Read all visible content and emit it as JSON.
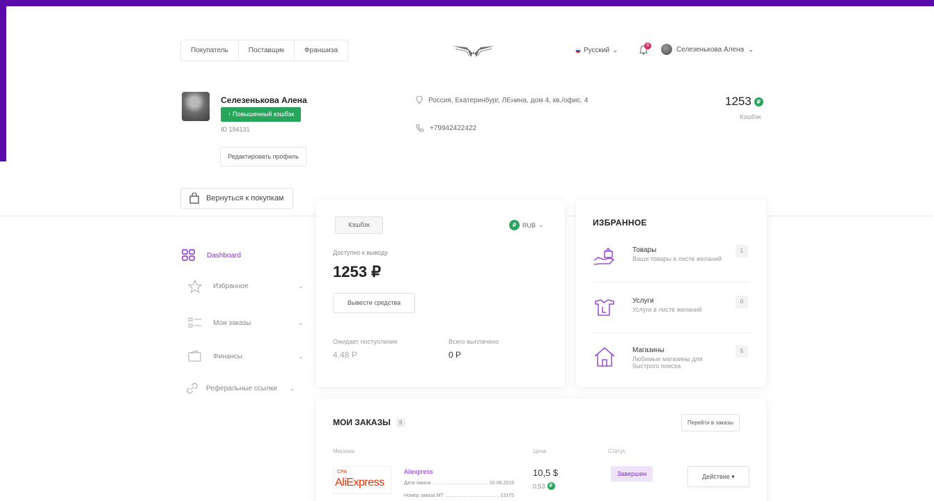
{
  "header": {
    "role_tabs": [
      "Покупатель",
      "Поставщик",
      "Франшиза"
    ],
    "language": "Русский",
    "notifications_count": "8",
    "user_name": "Селезенькова Алена"
  },
  "profile": {
    "name": "Селезенькова Алена",
    "badge": "↑  Повышенный кэшбэк",
    "id": "ID 194131",
    "edit_label": "Редактировать профиль",
    "address": "Россия, Екатеринбург, ЛЕнина, дом 4, кв./офис. 4",
    "phone": "+79942422422",
    "cashback_total": "1253",
    "cashback_caption": "Кэшбэк",
    "coin_symbol": "₽"
  },
  "back_label": "Вернуться к покупкам",
  "sidebar": {
    "items": [
      {
        "label": "Dashboard",
        "icon": "grid-icon",
        "active": true
      },
      {
        "label": "Избранное",
        "icon": "star-icon"
      },
      {
        "label": "Мои заказы",
        "icon": "list-icon"
      },
      {
        "label": "Финансы",
        "icon": "wallet-icon"
      },
      {
        "label": "Реферальные ссылки",
        "icon": "link-icon"
      }
    ]
  },
  "balance": {
    "tab_label": "Кэшбэк",
    "currency": "RUB",
    "available_label": "Доступно к выводу",
    "available_value": "1253 ₽",
    "withdraw_label": "Вывести средства",
    "pending_label": "Ожидает поступления",
    "pending_value": "4,48 Р",
    "paid_label": "Всего выплачено",
    "paid_value": "0 Р"
  },
  "favorites": {
    "title": "ИЗБРАННОЕ",
    "items": [
      {
        "title": "Товары",
        "desc": "Ваши товары в листе желаний",
        "count": "1"
      },
      {
        "title": "Услуги",
        "desc": "Услуги в листе желаний",
        "count": "0"
      },
      {
        "title": "Магазины",
        "desc": "Любимые магазины для быстрого поиска",
        "count": "5"
      }
    ]
  },
  "orders": {
    "title": "МОИ ЗАКАЗЫ",
    "count": "9",
    "goto_label": "Перейти в заказы",
    "columns": {
      "store": "Магазин",
      "price": "Цена",
      "status": "Статус"
    },
    "rows": [
      {
        "store_name": "Aliexpress",
        "logo_tag": "CPA",
        "logo_text_a": "Ali",
        "logo_text_b": "Express",
        "date_label": "Дата заказа",
        "date_value": "02.08.2019",
        "order_label": "Номер заказа МТ",
        "order_value": "13175",
        "price": "10,5 $",
        "cashback": "0,53",
        "status": "Завершен",
        "action_label": "Действие ▾"
      }
    ]
  },
  "colors": {
    "frame": "#5a0aa8",
    "accent": "#8a2bd0",
    "success": "#27a55d"
  }
}
